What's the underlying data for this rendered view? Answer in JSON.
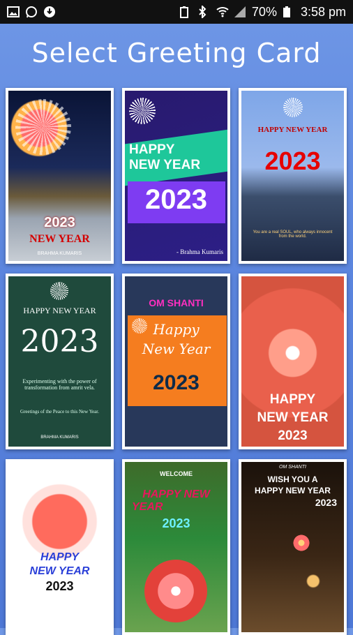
{
  "status_bar": {
    "battery": "70%",
    "time": "3:58 pm"
  },
  "header": {
    "title": "Select Greeting Card"
  },
  "cards": [
    {
      "line1": "2023",
      "line2": "NEW YEAR",
      "footer": "BRAHMA KUMARIS"
    },
    {
      "line1": "HAPPY",
      "line2": "NEW YEAR",
      "year": "2023",
      "footer": "- Brahma Kumaris"
    },
    {
      "line1": "HAPPY NEW YEAR",
      "year": "2023",
      "footer": "You are a real SOUL, who always innocent from the world."
    },
    {
      "line1": "HAPPY NEW YEAR",
      "year": "2023",
      "body": "Experimenting with the power of transformation from amrit vela.",
      "body2": "Greetings of the Peace to this New Year.",
      "footer": "BRAHMA KUMARIS"
    },
    {
      "top": "OM SHANTI",
      "line1": "Happy",
      "line2": "New Year",
      "year": "2023"
    },
    {
      "line1": "HAPPY",
      "line2": "NEW YEAR",
      "year": "2023"
    },
    {
      "line1": "HAPPY",
      "line2": "NEW YEAR",
      "year": "2023"
    },
    {
      "top": "WELCOME",
      "line1": "HAPPY NEW",
      "line2": "YEAR",
      "year": "2023"
    },
    {
      "top": "OM SHANTI",
      "line1": "WISH YOU A",
      "line2": "HAPPY NEW YEAR",
      "year": "2023"
    }
  ]
}
